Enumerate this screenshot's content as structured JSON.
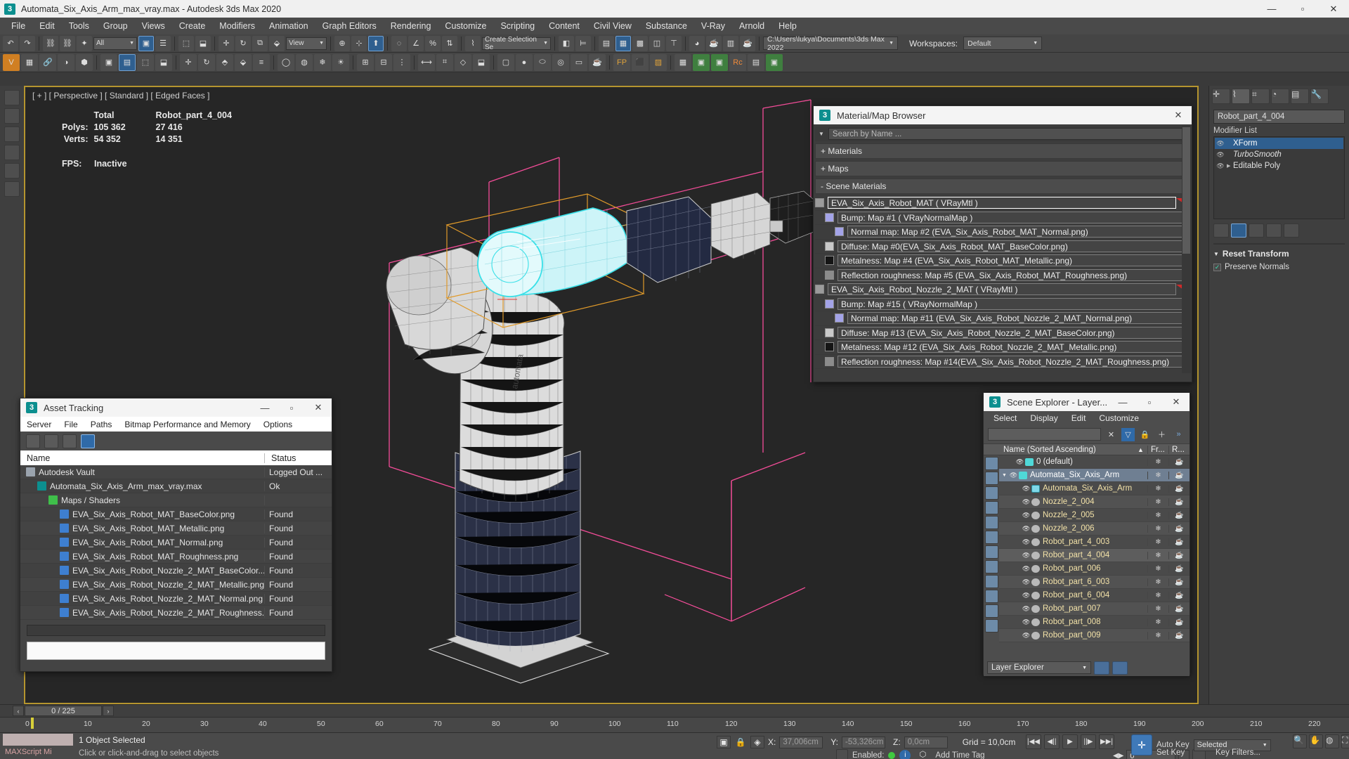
{
  "window": {
    "title": "Automata_Six_Axis_Arm_max_vray.max - Autodesk 3ds Max 2020",
    "app_icon": "3",
    "minimize": "—",
    "maximize": "▫",
    "close": "✕"
  },
  "menubar": {
    "items": [
      "File",
      "Edit",
      "Tools",
      "Group",
      "Views",
      "Create",
      "Modifiers",
      "Animation",
      "Graph Editors",
      "Rendering",
      "Customize",
      "Scripting",
      "Content",
      "Civil View",
      "Substance",
      "V-Ray",
      "Arnold",
      "Help"
    ]
  },
  "workspaces": {
    "label": "Workspaces:",
    "value": "Default"
  },
  "toolbar": {
    "selection_filter": "All",
    "coord_system": "View",
    "selection_set": "Create Selection Se",
    "project_path": "C:\\Users\\lukya\\Documents\\3ds Max 2022"
  },
  "viewport": {
    "label": "[ + ] [ Perspective ] [ Standard ] [ Edged Faces ]",
    "stats": {
      "col_total": "Total",
      "col_object": "Robot_part_4_004",
      "polys_label": "Polys:",
      "polys_total": "105 362",
      "polys_object": "27 416",
      "verts_label": "Verts:",
      "verts_total": "54 352",
      "verts_object": "14 351",
      "fps_label": "FPS:",
      "fps_value": "Inactive"
    }
  },
  "material_browser": {
    "title": "Material/Map Browser",
    "icon": "3",
    "close": "✕",
    "search_placeholder": "Search by Name ...",
    "groups": [
      {
        "label": "+ Materials"
      },
      {
        "label": "+ Maps"
      },
      {
        "label": "- Scene Materials"
      }
    ],
    "rows": [
      {
        "label": "EVA_Six_Axis_Robot_MAT  ( VRayMtl )",
        "indent": 0,
        "swatch": "#9b9b9b",
        "flag": true,
        "selected": true
      },
      {
        "label": "Bump: Map #1  ( VRayNormalMap )",
        "indent": 1,
        "swatch": "#a3a3e8",
        "flag": false,
        "selected": false
      },
      {
        "label": "Normal map: Map #2 (EVA_Six_Axis_Robot_MAT_Normal.png)",
        "indent": 2,
        "swatch": "#a3a3e8",
        "flag": false,
        "selected": false
      },
      {
        "label": "Diffuse: Map #0(EVA_Six_Axis_Robot_MAT_BaseColor.png)",
        "indent": 1,
        "swatch": "#c9c9c9",
        "flag": false,
        "selected": false
      },
      {
        "label": "Metalness: Map #4 (EVA_Six_Axis_Robot_MAT_Metallic.png)",
        "indent": 1,
        "swatch": "#151515",
        "flag": false,
        "selected": false
      },
      {
        "label": "Reflection roughness: Map #5 (EVA_Six_Axis_Robot_MAT_Roughness.png)",
        "indent": 1,
        "swatch": "#8c8c8c",
        "flag": false,
        "selected": false
      },
      {
        "label": "EVA_Six_Axis_Robot_Nozzle_2_MAT  ( VRayMtl )",
        "indent": 0,
        "swatch": "#9b9b9b",
        "flag": true,
        "selected": false
      },
      {
        "label": "Bump: Map #15  ( VRayNormalMap )",
        "indent": 1,
        "swatch": "#a3a3e8",
        "flag": false,
        "selected": false
      },
      {
        "label": "Normal map: Map #11 (EVA_Six_Axis_Robot_Nozzle_2_MAT_Normal.png)",
        "indent": 2,
        "swatch": "#a3a3e8",
        "flag": false,
        "selected": false
      },
      {
        "label": "Diffuse: Map #13 (EVA_Six_Axis_Robot_Nozzle_2_MAT_BaseColor.png)",
        "indent": 1,
        "swatch": "#c9c9c9",
        "flag": false,
        "selected": false
      },
      {
        "label": "Metalness: Map #12 (EVA_Six_Axis_Robot_Nozzle_2_MAT_Metallic.png)",
        "indent": 1,
        "swatch": "#151515",
        "flag": false,
        "selected": false
      },
      {
        "label": "Reflection roughness: Map #14(EVA_Six_Axis_Robot_Nozzle_2_MAT_Roughness.png)",
        "indent": 1,
        "swatch": "#8c8c8c",
        "flag": false,
        "selected": false
      }
    ]
  },
  "asset_tracking": {
    "title": "Asset Tracking",
    "icon": "3",
    "minimize": "—",
    "maximize": "▫",
    "close": "✕",
    "menu": [
      "Server",
      "File",
      "Paths",
      "Bitmap Performance and Memory",
      "Options"
    ],
    "columns": {
      "name": "Name",
      "status": "Status"
    },
    "rows": [
      {
        "name": "Autodesk Vault",
        "status": "Logged Out ...",
        "indent": 0,
        "icon": "#9aa3ad"
      },
      {
        "name": "Automata_Six_Axis_Arm_max_vray.max",
        "status": "Ok",
        "indent": 1,
        "icon": "#0c8f8f"
      },
      {
        "name": "Maps / Shaders",
        "status": "",
        "indent": 2,
        "icon": "#3fbf4a"
      },
      {
        "name": "EVA_Six_Axis_Robot_MAT_BaseColor.png",
        "status": "Found",
        "indent": 3,
        "icon": "#3e7fd0"
      },
      {
        "name": "EVA_Six_Axis_Robot_MAT_Metallic.png",
        "status": "Found",
        "indent": 3,
        "icon": "#3e7fd0"
      },
      {
        "name": "EVA_Six_Axis_Robot_MAT_Normal.png",
        "status": "Found",
        "indent": 3,
        "icon": "#3e7fd0"
      },
      {
        "name": "EVA_Six_Axis_Robot_MAT_Roughness.png",
        "status": "Found",
        "indent": 3,
        "icon": "#3e7fd0"
      },
      {
        "name": "EVA_Six_Axis_Robot_Nozzle_2_MAT_BaseColor....",
        "status": "Found",
        "indent": 3,
        "icon": "#3e7fd0"
      },
      {
        "name": "EVA_Six_Axis_Robot_Nozzle_2_MAT_Metallic.png",
        "status": "Found",
        "indent": 3,
        "icon": "#3e7fd0"
      },
      {
        "name": "EVA_Six_Axis_Robot_Nozzle_2_MAT_Normal.png",
        "status": "Found",
        "indent": 3,
        "icon": "#3e7fd0"
      },
      {
        "name": "EVA_Six_Axis_Robot_Nozzle_2_MAT_Roughness...",
        "status": "Found",
        "indent": 3,
        "icon": "#3e7fd0"
      }
    ]
  },
  "scene_explorer": {
    "title": "Scene Explorer - Layer...",
    "icon": "3",
    "minimize": "—",
    "maximize": "▫",
    "close": "✕",
    "menu": [
      "Select",
      "Display",
      "Edit",
      "Customize"
    ],
    "filter_value": "",
    "clear_icon": "✕",
    "columns": {
      "name": "Name (Sorted Ascending)",
      "sort_arrow": "▲",
      "frozen": "Fr...",
      "render": "R..."
    },
    "rows": [
      {
        "label": "0 (default)",
        "indent": 1,
        "kind": "layer",
        "state": "normal"
      },
      {
        "label": "Automata_Six_Axis_Arm",
        "indent": 0,
        "kind": "layer-open",
        "state": "sel"
      },
      {
        "label": "Automata_Six_Axis_Arm",
        "indent": 2,
        "kind": "group",
        "state": "normal"
      },
      {
        "label": "Nozzle_2_004",
        "indent": 2,
        "kind": "object",
        "state": "normal"
      },
      {
        "label": "Nozzle_2_005",
        "indent": 2,
        "kind": "object",
        "state": "normal"
      },
      {
        "label": "Nozzle_2_006",
        "indent": 2,
        "kind": "object",
        "state": "normal"
      },
      {
        "label": "Robot_part_4_003",
        "indent": 2,
        "kind": "object",
        "state": "normal"
      },
      {
        "label": "Robot_part_4_004",
        "indent": 2,
        "kind": "object",
        "state": "hl"
      },
      {
        "label": "Robot_part_006",
        "indent": 2,
        "kind": "object",
        "state": "normal"
      },
      {
        "label": "Robot_part_6_003",
        "indent": 2,
        "kind": "object",
        "state": "normal"
      },
      {
        "label": "Robot_part_6_004",
        "indent": 2,
        "kind": "object",
        "state": "normal"
      },
      {
        "label": "Robot_part_007",
        "indent": 2,
        "kind": "object",
        "state": "normal"
      },
      {
        "label": "Robot_part_008",
        "indent": 2,
        "kind": "object",
        "state": "normal"
      },
      {
        "label": "Robot_part_009",
        "indent": 2,
        "kind": "object",
        "state": "normal"
      }
    ],
    "footer_select": "Layer Explorer"
  },
  "command_panel": {
    "object_name": "Robot_part_4_004",
    "modifier_list_label": "Modifier List",
    "modifiers": [
      {
        "label": "XForm",
        "selected": true,
        "italic": false
      },
      {
        "label": "TurboSmooth",
        "selected": false,
        "italic": true
      },
      {
        "label": "Editable Poly",
        "selected": false,
        "italic": false
      }
    ],
    "rollout_title": "Reset Transform",
    "preserve_normals": "Preserve Normals",
    "checkmark": "✓"
  },
  "timeline": {
    "frame_field": "0 / 225",
    "prev_arrow": "‹",
    "next_arrow": "›",
    "ticks": [
      "0",
      "10",
      "20",
      "30",
      "40",
      "50",
      "60",
      "70",
      "80",
      "90",
      "100",
      "110",
      "120",
      "130",
      "140",
      "150",
      "160",
      "170",
      "180",
      "190",
      "200",
      "210",
      "220"
    ]
  },
  "statusbar": {
    "maxscript_label": "MAXScript Mi",
    "object_selected": "1 Object Selected",
    "hint": "Click or click-and-drag to select objects",
    "x_label": "X:",
    "x_value": "37,006cm",
    "y_label": "Y:",
    "y_value": "-53,326cm",
    "z_label": "Z:",
    "z_value": "0,0cm",
    "grid": "Grid = 10,0cm",
    "enabled_label": "Enabled:",
    "add_time_tag": "Add Time Tag",
    "auto_key": "Auto Key",
    "set_key": "Set Key",
    "key_filters": "Key Filters...",
    "selected_dropdown": "Selected",
    "key_field": "0",
    "playback": [
      "|◀◀",
      "◀||",
      "▶",
      "||▶",
      "▶▶|"
    ]
  },
  "colors": {
    "accent_blue": "#2f6aa8",
    "viewport_border": "#b5952f",
    "grid_pink": "#ff4f9f",
    "selection_cyan": "#38e0e8"
  }
}
